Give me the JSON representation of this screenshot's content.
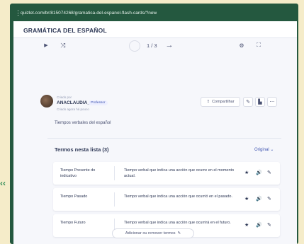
{
  "browser": {
    "url": "quizlet.com/br/815074268/gramatica-del-espanol-flash-cards/?new"
  },
  "header": {
    "title": "GRAMÁTICA DEL ESPAÑOL"
  },
  "controls": {
    "counter": "1 / 3"
  },
  "author": {
    "created_by": "Criado por",
    "username": "ANACLAUDIA_13",
    "badge": "Professor",
    "subline": "Criado agora há pouco",
    "share_label": "Compartilhar"
  },
  "description": "Tiempos verbales del español",
  "terms": {
    "heading": "Termos nesta lista (3)",
    "sort_label": "Original",
    "items": [
      {
        "term": "Tiempo Presente do indicativo",
        "definition": "Tiempo verbal que indica una acción que ocurre en el momento actual."
      },
      {
        "term": "Tiempo Pasado",
        "definition": "Tiempo verbal que indica una acción que ocurrió en el pasado."
      },
      {
        "term": "Tiempo Futuro",
        "definition": "Tiempo verbal que indica una acción que ocurrirá en el futuro."
      }
    ],
    "add_remove_label": "Adicionar ou remover termos"
  },
  "colors": {
    "frame_green": "#24583f",
    "page_bg": "#f6f7fb",
    "outer_bg": "#f5ecc9",
    "accent_blue": "#4257b2"
  },
  "icons": [
    "menu-dots-icon",
    "play-icon",
    "shuffle-icon",
    "arrow-right-icon",
    "settings-icon",
    "fullscreen-icon",
    "share-icon",
    "pencil-icon",
    "stats-icon",
    "more-icon",
    "star-icon",
    "audio-icon",
    "edit-icon",
    "chevron-left-icon"
  ]
}
